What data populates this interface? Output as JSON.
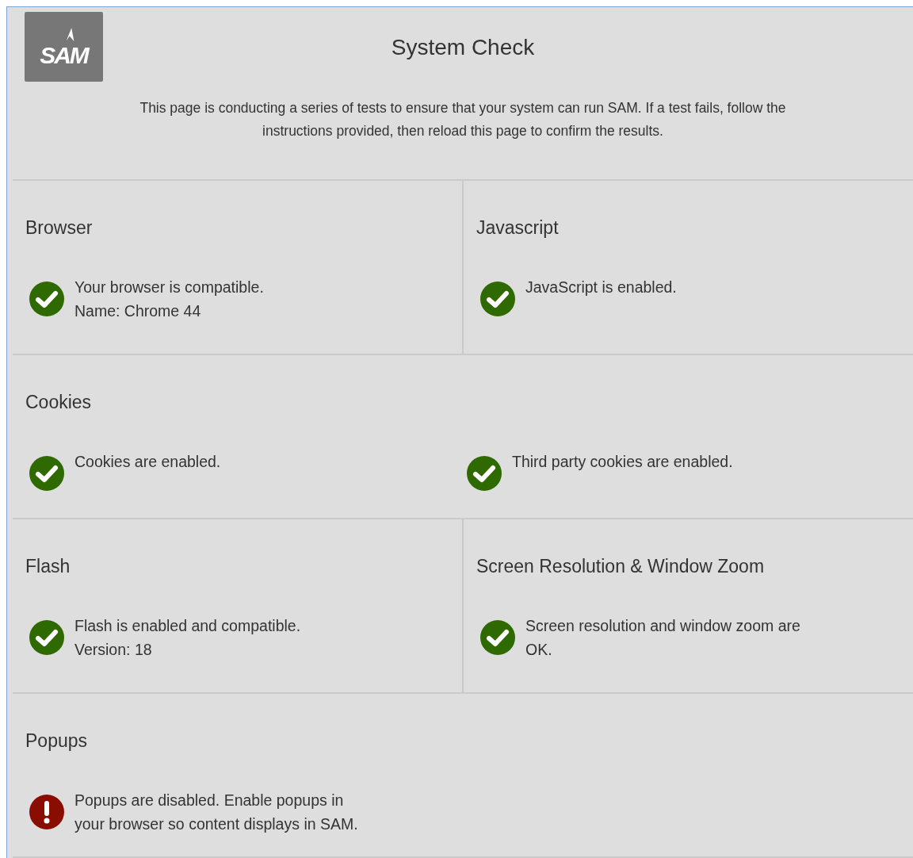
{
  "header": {
    "logo": "SAM",
    "title": "System Check",
    "intro": [
      "This page is conducting a series of tests to ensure that your system can run SAM. If a test fails, follow the",
      "instructions provided, then reload this page to confirm the results."
    ]
  },
  "sections": [
    {
      "kind": "split",
      "cells": [
        {
          "title": "Browser",
          "results": [
            {
              "kind": "pass",
              "lines": [
                "Your browser is compatible.",
                "Name: Chrome 44"
              ]
            }
          ]
        },
        {
          "title": "Javascript",
          "results": [
            {
              "kind": "pass",
              "lines": [
                "JavaScript is enabled."
              ]
            }
          ]
        }
      ]
    },
    {
      "kind": "full",
      "title": "Cookies",
      "results": [
        {
          "kind": "pass",
          "lines": [
            "Cookies are enabled."
          ]
        },
        {
          "kind": "pass",
          "lines": [
            "Third party cookies are enabled."
          ]
        }
      ]
    },
    {
      "kind": "split",
      "cells": [
        {
          "title": "Flash",
          "results": [
            {
              "kind": "pass",
              "lines": [
                "Flash is enabled and compatible.",
                "Version: 18"
              ]
            }
          ]
        },
        {
          "title": "Screen Resolution & Window Zoom",
          "results": [
            {
              "kind": "pass",
              "lines": [
                "Screen resolution and window zoom are",
                "OK."
              ]
            }
          ]
        }
      ]
    },
    {
      "kind": "full",
      "title": "Popups",
      "results": [
        {
          "kind": "fail",
          "lines": [
            "Popups are disabled. Enable popups in",
            "your browser so content displays in SAM."
          ]
        }
      ]
    }
  ]
}
